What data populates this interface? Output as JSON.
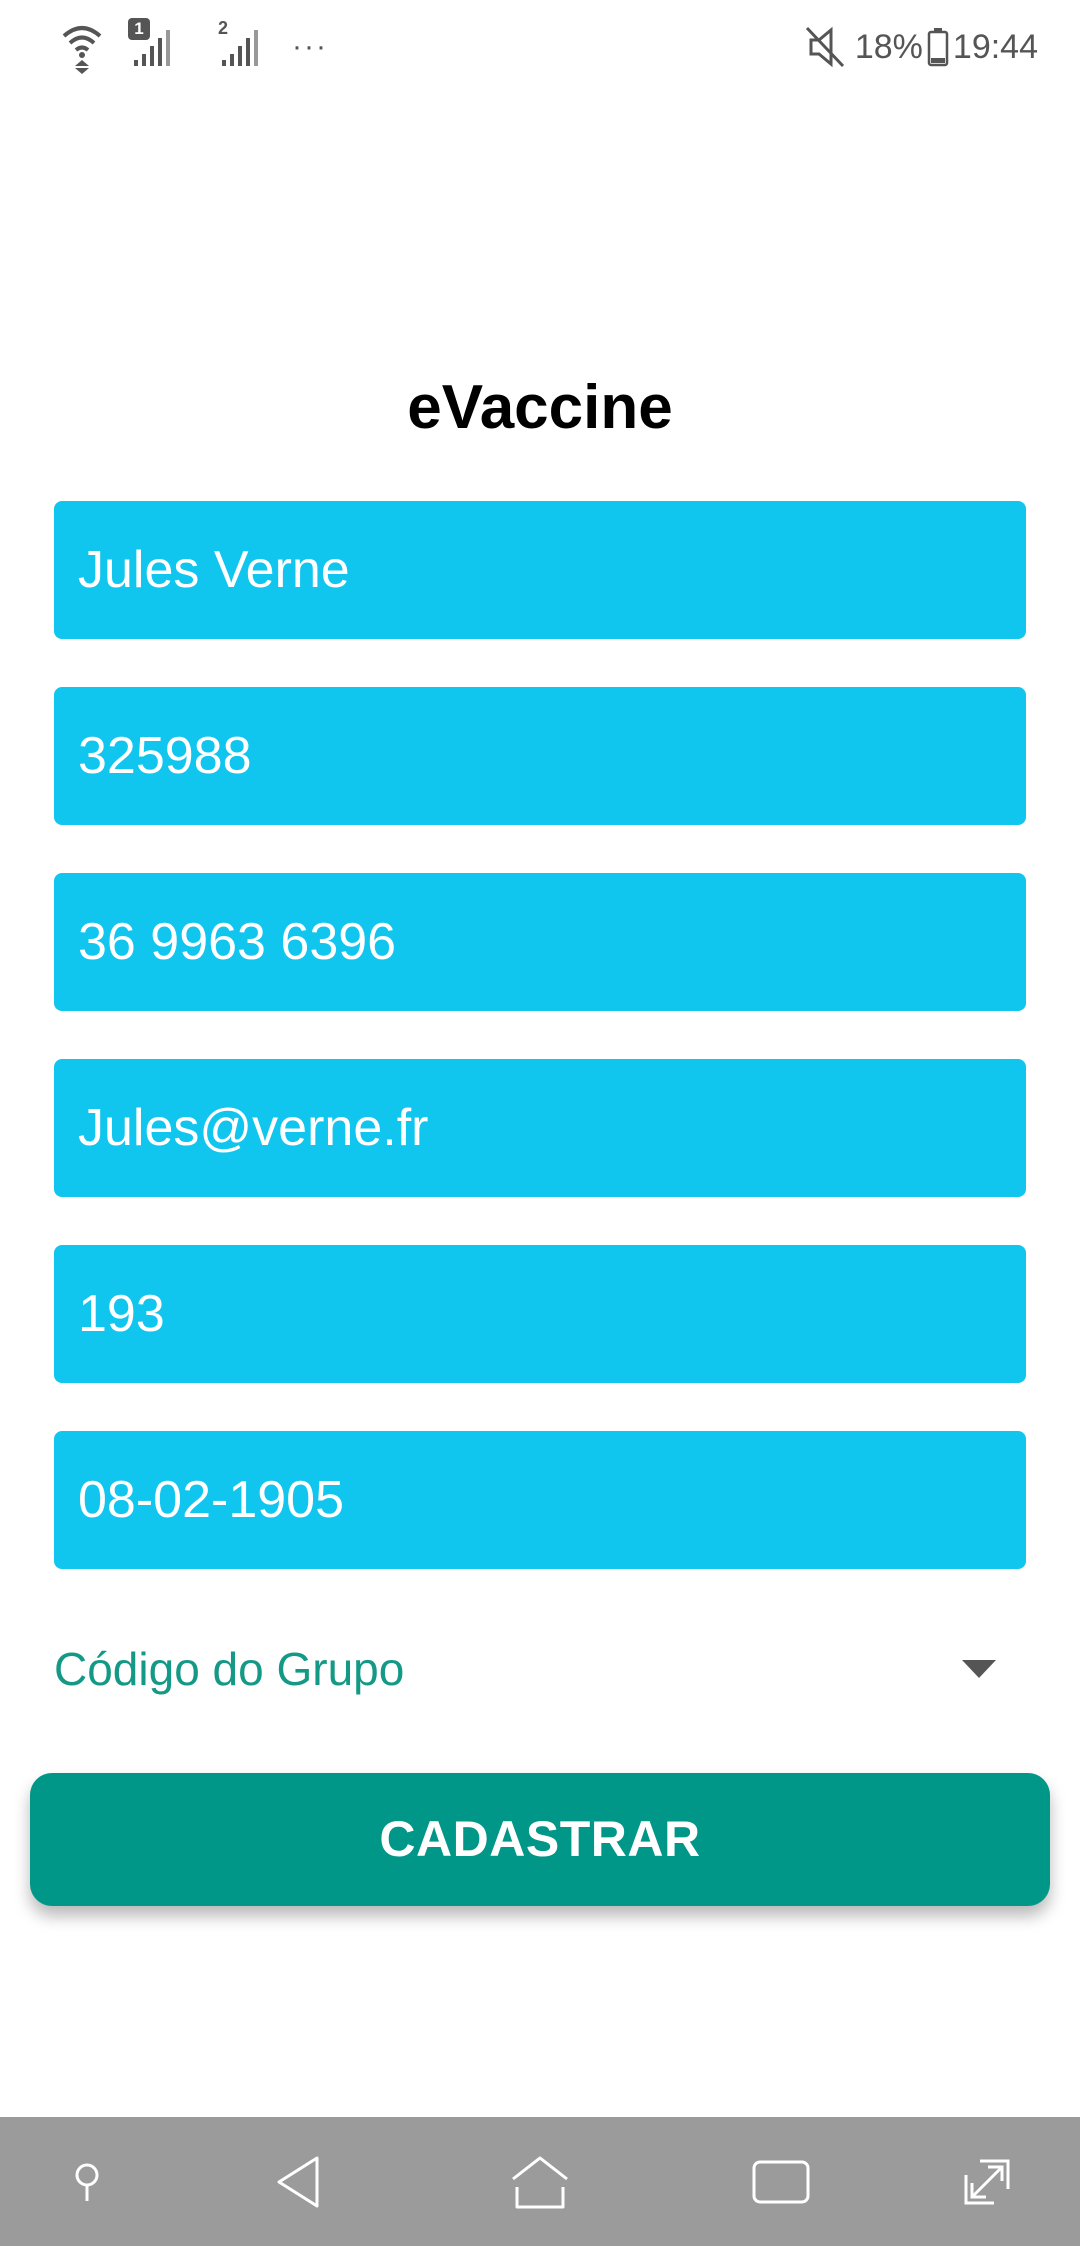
{
  "status_bar": {
    "sim1_label": "1",
    "sim2_label": "2",
    "more_indicator": "···",
    "battery_percent": "18%",
    "time": "19:44",
    "icons": [
      "wifi-icon",
      "signal-sim1-icon",
      "signal-sim2-icon",
      "mute-icon",
      "battery-icon"
    ]
  },
  "app": {
    "title": "eVaccine"
  },
  "form": {
    "fields": [
      {
        "value": "Jules Verne"
      },
      {
        "value": "325988"
      },
      {
        "value": "36 9963 6396"
      },
      {
        "value": "Jules@verne.fr"
      },
      {
        "value": "193"
      },
      {
        "value": "08-02-1905"
      }
    ],
    "group_dropdown": {
      "label": "Código do Grupo"
    },
    "submit_label": "CADASTRAR"
  },
  "nav_bar": {
    "buttons": [
      "pin-icon",
      "back-icon",
      "home-icon",
      "recents-icon",
      "fullscreen-icon"
    ]
  },
  "colors": {
    "field_bg": "#10c5ee",
    "accent": "#009788",
    "dropdown_text": "#159987",
    "nav_bg": "#9b9b9b"
  }
}
